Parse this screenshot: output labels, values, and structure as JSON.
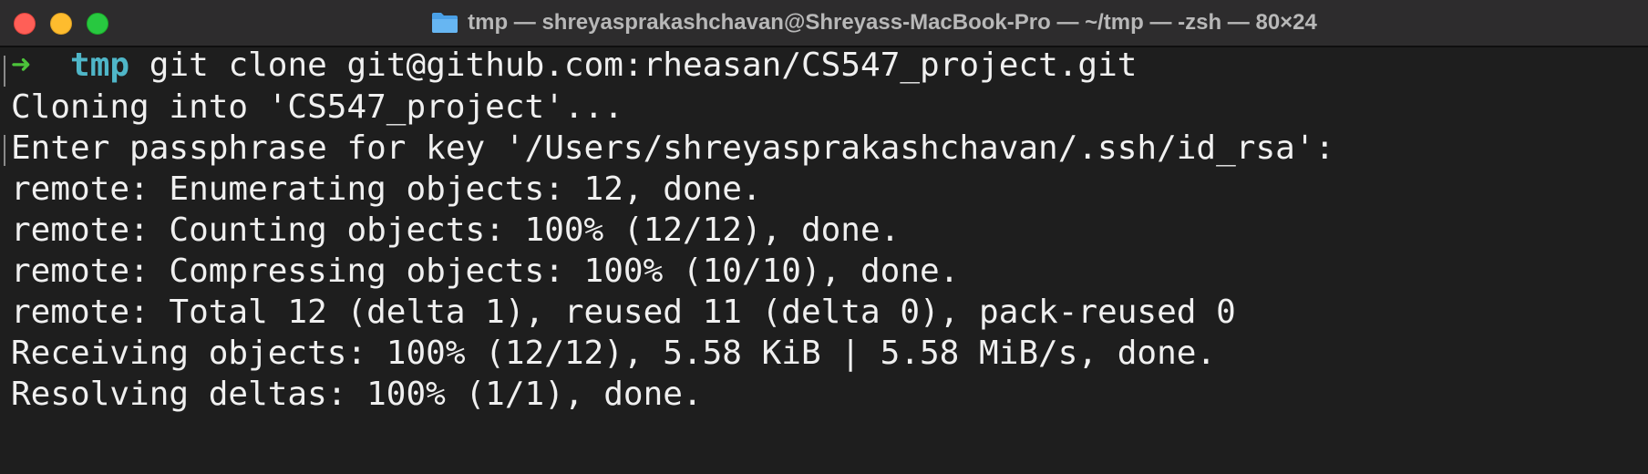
{
  "window": {
    "title": "tmp — shreyasprakashchavan@Shreyass-MacBook-Pro — ~/tmp — -zsh — 80×24",
    "title_icon": "folder-icon",
    "colors": {
      "background": "#1e1e1e",
      "titlebar": "#2d2c2d",
      "text": "#f0f0f0",
      "prompt_arrow": "#4cc43a",
      "prompt_dir": "#4fb6c8"
    }
  },
  "terminal": {
    "prompt": {
      "arrow": "➜",
      "dir": "tmp",
      "command": "git clone git@github.com:rheasan/CS547_project.git"
    },
    "output": [
      "Cloning into 'CS547_project'...",
      "Enter passphrase for key '/Users/shreyasprakashchavan/.ssh/id_rsa':",
      "remote: Enumerating objects: 12, done.",
      "remote: Counting objects: 100% (12/12), done.",
      "remote: Compressing objects: 100% (10/10), done.",
      "remote: Total 12 (delta 1), reused 11 (delta 0), pack-reused 0",
      "Receiving objects: 100% (12/12), 5.58 KiB | 5.58 MiB/s, done.",
      "Resolving deltas: 100% (1/1), done."
    ]
  }
}
